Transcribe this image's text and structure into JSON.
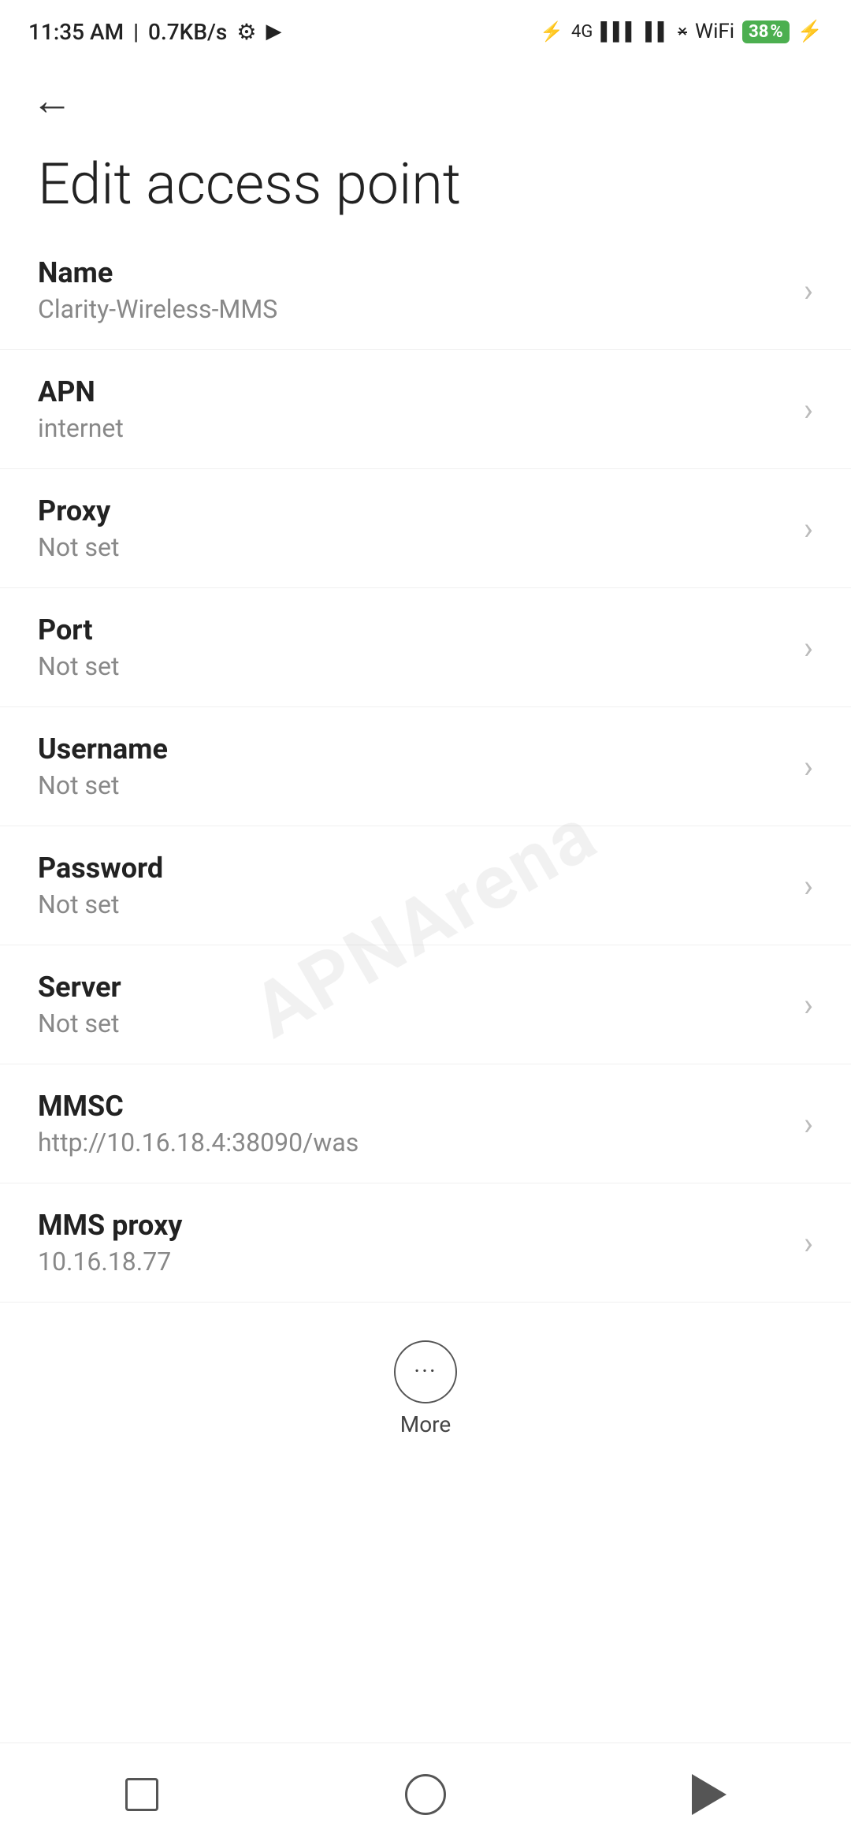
{
  "statusBar": {
    "time": "11:35 AM",
    "speed": "0.7KB/s",
    "batteryPercent": "38"
  },
  "nav": {
    "backLabel": "←"
  },
  "page": {
    "title": "Edit access point"
  },
  "settings": [
    {
      "label": "Name",
      "value": "Clarity-Wireless-MMS"
    },
    {
      "label": "APN",
      "value": "internet"
    },
    {
      "label": "Proxy",
      "value": "Not set"
    },
    {
      "label": "Port",
      "value": "Not set"
    },
    {
      "label": "Username",
      "value": "Not set"
    },
    {
      "label": "Password",
      "value": "Not set"
    },
    {
      "label": "Server",
      "value": "Not set"
    },
    {
      "label": "MMSC",
      "value": "http://10.16.18.4:38090/was"
    },
    {
      "label": "MMS proxy",
      "value": "10.16.18.77"
    }
  ],
  "moreButton": {
    "label": "More"
  },
  "watermark": "APNArena",
  "bottomNav": {
    "square": "square-button",
    "circle": "home-button",
    "triangle": "back-button"
  }
}
